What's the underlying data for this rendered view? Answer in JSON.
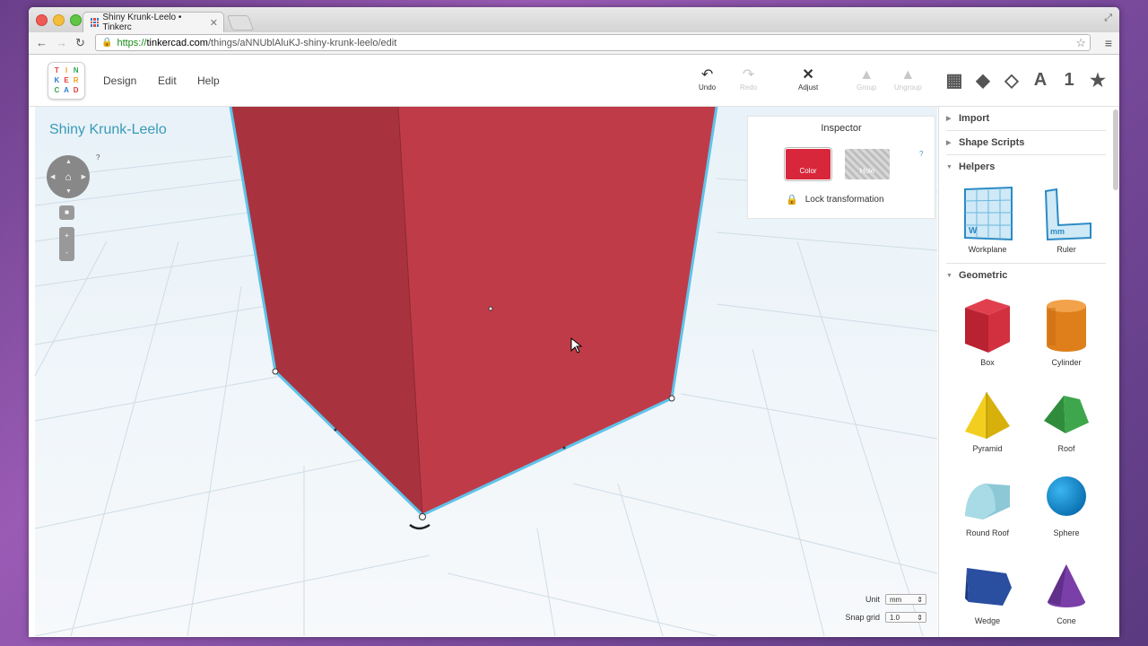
{
  "browser": {
    "tab_title": "Shiny Krunk-Leelo • Tinkerc",
    "tab_close": "✕",
    "url_https": "https://",
    "url_host": "tinkercad.com",
    "url_path": "/things/aNNUblAluKJ-shiny-krunk-leelo/edit"
  },
  "app": {
    "logo_letters": [
      "T",
      "I",
      "N",
      "K",
      "E",
      "R",
      "C",
      "A",
      "D"
    ],
    "menu": [
      "Design",
      "Edit",
      "Help"
    ],
    "tools": [
      {
        "label": "Undo",
        "icon": "undo-icon",
        "enabled": true
      },
      {
        "label": "Redo",
        "icon": "redo-icon",
        "enabled": false
      },
      {
        "label": "Adjust",
        "icon": "adjust-icon",
        "enabled": true
      },
      {
        "label": "Group",
        "icon": "group-icon",
        "enabled": false
      },
      {
        "label": "Ungroup",
        "icon": "ungroup-icon",
        "enabled": false
      }
    ],
    "view_icons": [
      "grid-icon",
      "cube-icon",
      "cube-outline-icon",
      "A",
      "1",
      "star-icon"
    ]
  },
  "workspace": {
    "project_title": "Shiny Krunk-Leelo",
    "help_mark": "?",
    "zoom_in": "+",
    "zoom_out": "-",
    "unit_label": "Unit",
    "unit_value": "mm",
    "snap_label": "Snap grid",
    "snap_value": "1.0"
  },
  "inspector": {
    "title": "Inspector",
    "color_label": "Color",
    "hole_label": "Hole",
    "help_mark": "?",
    "lock_label": "Lock transformation",
    "shape_color": "#c33a48"
  },
  "sidebar": {
    "sections": [
      {
        "label": "Import",
        "expanded": false
      },
      {
        "label": "Shape Scripts",
        "expanded": false
      },
      {
        "label": "Helpers",
        "expanded": true
      },
      {
        "label": "Geometric",
        "expanded": true
      }
    ],
    "helpers": [
      "Workplane",
      "Ruler"
    ],
    "geometric": [
      "Box",
      "Cylinder",
      "Pyramid",
      "Roof",
      "Round Roof",
      "Sphere",
      "Wedge",
      "Cone"
    ]
  }
}
